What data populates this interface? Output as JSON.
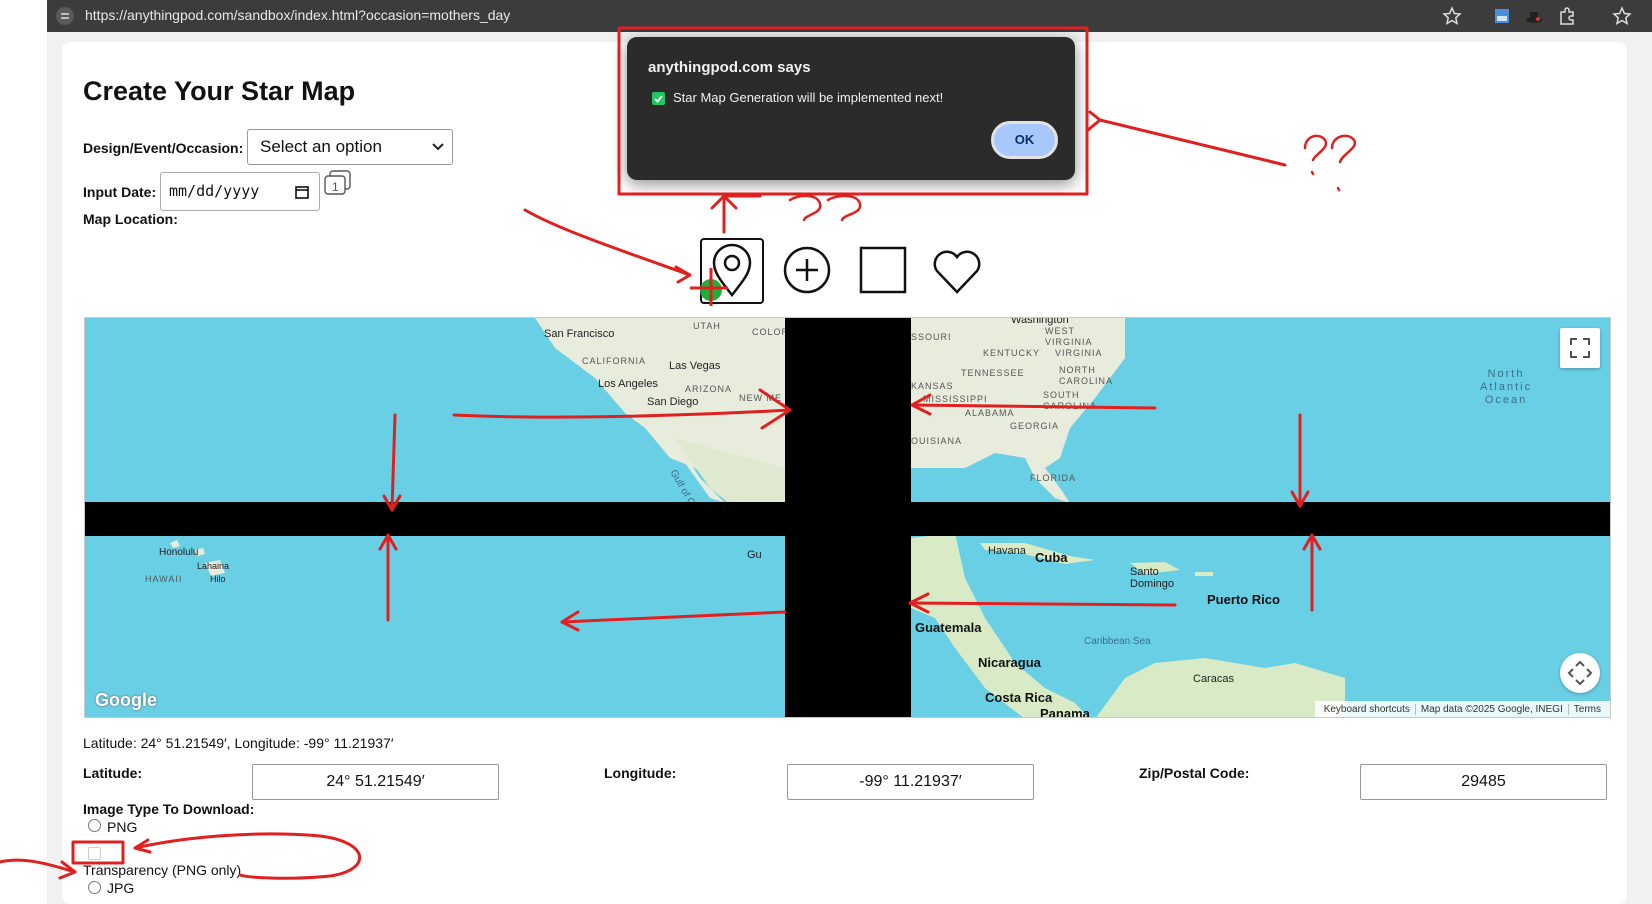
{
  "browser": {
    "url": "https://anythingpod.com/sandbox/index.html?occasion=mothers_day"
  },
  "page": {
    "title": "Create Your Star Map",
    "occasion": {
      "label": "Design/Event/Occasion:",
      "selected": "Select an option"
    },
    "date": {
      "label": "Input Date:",
      "placeholder": "mm/dd/yyyy"
    },
    "map_location_label": "Map Location:",
    "coords_readout": "Latitude: 24° 51.21549′, Longitude: -99° 11.21937′",
    "latitude": {
      "label": "Latitude:",
      "value": "24° 51.21549′"
    },
    "longitude": {
      "label": "Longitude:",
      "value": "-99° 11.21937′"
    },
    "zip": {
      "label": "Zip/Postal Code:",
      "value": "29485"
    },
    "image_type": {
      "label": "Image Type To Download:",
      "png": "PNG",
      "transparency": "Transparency (PNG only)",
      "jpg": "JPG"
    }
  },
  "toolbar_icons": [
    "map-pin-icon",
    "plus-circle-icon",
    "square-icon",
    "heart-icon"
  ],
  "map": {
    "labels": {
      "washington": "Washington",
      "san_francisco": "San Francisco",
      "utah": "UTAH",
      "colorado": "COLORA",
      "california": "CALIFORNIA",
      "las_vegas": "Las Vegas",
      "los_angeles": "Los Angeles",
      "arizona": "ARIZONA",
      "san_diego": "San Diego",
      "new_mexico": "NEW ME",
      "missouri": "SSOURI",
      "west_virginia": "WEST\nVIRGINIA",
      "kentucky": "KENTUCKY",
      "virginia": "VIRGINIA",
      "tennessee": "TENNESSEE",
      "north_carolina": "NORTH\nCAROLINA",
      "arkansas": "KANSAS",
      "mississippi": "MISSISSIPPI",
      "south_carolina": "SOUTH\nCAROLINA",
      "alabama": "ALABAMA",
      "georgia": "GEORGIA",
      "louisiana": "OUISIANA",
      "florida": "FLORIDA",
      "north_atlantic": "North\nAtlantic\nOcean",
      "gulf": "Gulf of Calif",
      "honolulu": "Honolulu",
      "lahaina": "Lahaina",
      "hawaii": "HAWAII",
      "hilo": "Hilo",
      "havana": "Havana",
      "cuba": "Cuba",
      "santo_domingo": "Santo\nDomingo",
      "puerto_rico": "Puerto Rico",
      "guatemala": "Guatemala",
      "caribbean": "Caribbean Sea",
      "nicaragua": "Nicaragua",
      "caracas": "Caracas",
      "costa_rica": "Costa Rica",
      "panama": "Panama",
      "gu": "Gu"
    },
    "footer": {
      "shortcuts": "Keyboard shortcuts",
      "mapdata": "Map data ©2025 Google, INEGI",
      "terms": "Terms"
    },
    "logo": "Google"
  },
  "dialog": {
    "title": "anythingpod.com says",
    "message": "Star Map Generation will be implemented next!",
    "ok": "OK"
  },
  "colors": {
    "water": "#69cfe5",
    "land": "#e8ecdd",
    "annotation": "#e02020",
    "dialog_bg": "#2b2b2b",
    "ok_button": "#a8c7fa"
  }
}
